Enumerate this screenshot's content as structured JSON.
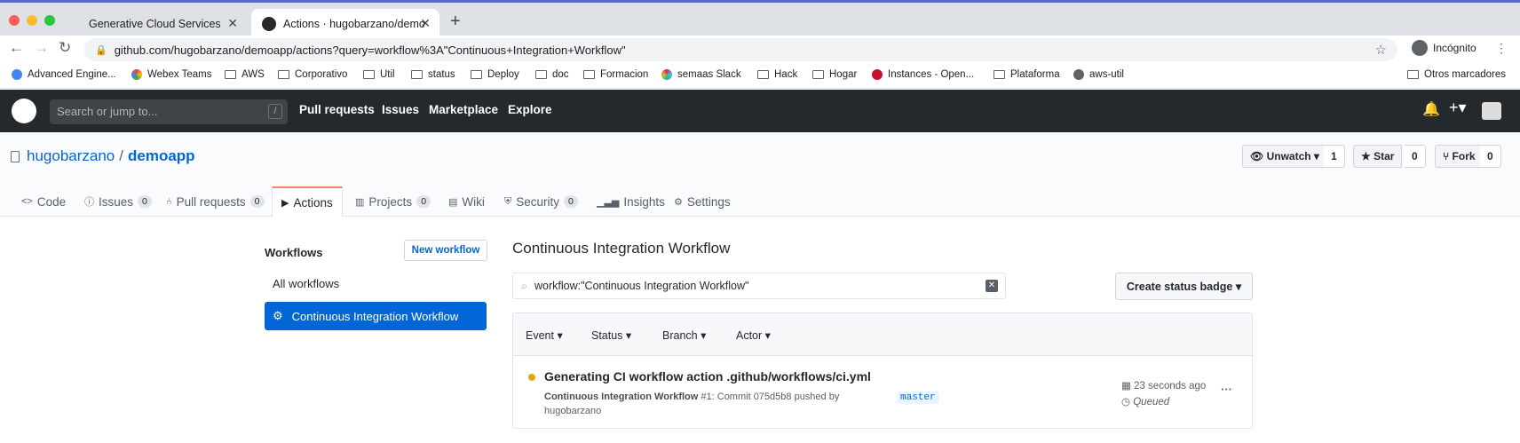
{
  "browser": {
    "tabs": [
      {
        "title": "Generative Cloud Services"
      },
      {
        "title": "Actions · hugobarzano/demoap"
      }
    ],
    "url": "github.com/hugobarzano/demoapp/actions?query=workflow%3A\"Continuous+Integration+Workflow\"",
    "profile": "Incógnito",
    "bookmarks": [
      "Advanced Engine...",
      "Webex Teams",
      "AWS",
      "Corporativo",
      "Util",
      "status",
      "Deploy",
      "doc",
      "Formacion",
      "semaas Slack",
      "Hack",
      "Hogar",
      "Instances - Open...",
      "Plataforma",
      "aws-util"
    ],
    "other_bookmarks": "Otros marcadores"
  },
  "header": {
    "search_placeholder": "Search or jump to...",
    "slash": "/",
    "nav": [
      "Pull requests",
      "Issues",
      "Marketplace",
      "Explore"
    ]
  },
  "repo": {
    "owner": "hugobarzano",
    "sep": "/",
    "name": "demoapp",
    "unwatch": "Unwatch",
    "unwatch_count": "1",
    "star": "Star",
    "star_count": "0",
    "fork": "Fork",
    "fork_count": "0",
    "tabs": [
      {
        "label": "Code"
      },
      {
        "label": "Issues",
        "count": "0"
      },
      {
        "label": "Pull requests",
        "count": "0"
      },
      {
        "label": "Actions"
      },
      {
        "label": "Projects",
        "count": "0"
      },
      {
        "label": "Wiki"
      },
      {
        "label": "Security",
        "count": "0"
      },
      {
        "label": "Insights"
      },
      {
        "label": "Settings"
      }
    ]
  },
  "sidebar": {
    "heading": "Workflows",
    "new_workflow": "New workflow",
    "items": [
      "All workflows",
      "Continuous Integration Workflow"
    ]
  },
  "main": {
    "title": "Continuous Integration Workflow",
    "filter_value": "workflow:\"Continuous Integration Workflow\"",
    "status_badge_button": "Create status badge",
    "filters": [
      "Event",
      "Status",
      "Branch",
      "Actor"
    ],
    "run": {
      "title": "Generating CI workflow action .github/workflows/ci.yml",
      "workflow": "Continuous Integration Workflow",
      "meta_line1": " #1: Commit 075d5b8 pushed by",
      "meta_line2": "hugobarzano",
      "branch": "master",
      "time": "23 seconds ago",
      "status": "Queued",
      "status_color": "#dbab09"
    }
  }
}
